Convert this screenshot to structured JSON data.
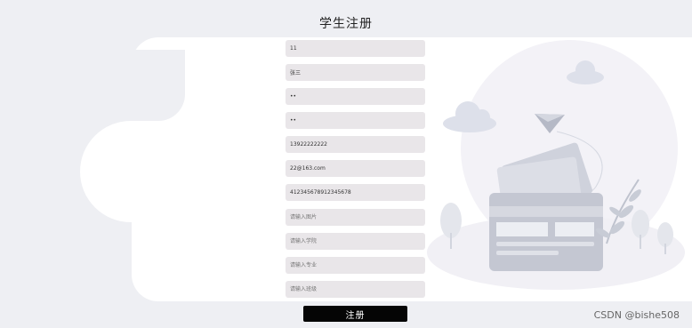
{
  "page": {
    "title": "学生注册"
  },
  "form": {
    "fields": [
      {
        "name": "student-id-field",
        "value": "11",
        "placeholder": ""
      },
      {
        "name": "name-field",
        "value": "张三",
        "placeholder": ""
      },
      {
        "name": "password-field",
        "value": "••",
        "placeholder": ""
      },
      {
        "name": "confirm-password-field",
        "value": "••",
        "placeholder": ""
      },
      {
        "name": "phone-field",
        "value": "13922222222",
        "placeholder": ""
      },
      {
        "name": "email-field",
        "value": "22@163.com",
        "placeholder": ""
      },
      {
        "name": "id-card-field",
        "value": "412345678912345678",
        "placeholder": ""
      },
      {
        "name": "avatar-field",
        "value": "",
        "placeholder": "请输入图片"
      },
      {
        "name": "college-field",
        "value": "",
        "placeholder": "请输入学院"
      },
      {
        "name": "major-field",
        "value": "",
        "placeholder": "请输入专业"
      },
      {
        "name": "class-field",
        "value": "",
        "placeholder": "请输入班级"
      }
    ],
    "submit_label": "注册"
  },
  "watermark": "CSDN @bishe508",
  "colors": {
    "background": "#eeeff3",
    "field": "#e9e6e9",
    "button": "#050505"
  },
  "icons": [
    "paper-plane-icon",
    "cloud-icon",
    "card-icon",
    "leaf-icon",
    "tree-icon"
  ]
}
